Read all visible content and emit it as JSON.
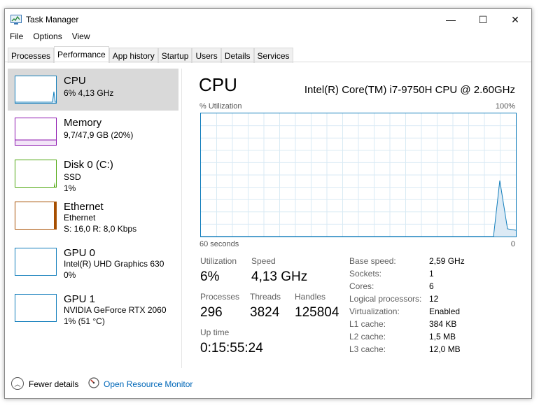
{
  "window": {
    "title": "Task Manager",
    "controls": {
      "minimize": "—",
      "maximize": "☐",
      "close": "✕"
    }
  },
  "menu": [
    "File",
    "Options",
    "View"
  ],
  "tabs": [
    {
      "label": "Processes",
      "active": false
    },
    {
      "label": "Performance",
      "active": true
    },
    {
      "label": "App history",
      "active": false
    },
    {
      "label": "Startup",
      "active": false
    },
    {
      "label": "Users",
      "active": false
    },
    {
      "label": "Details",
      "active": false
    },
    {
      "label": "Services",
      "active": false
    }
  ],
  "resources": [
    {
      "name": "CPU",
      "sub1": "6% 4,13 GHz",
      "sub2": "",
      "color": "#117dbb",
      "selected": true
    },
    {
      "name": "Memory",
      "sub1": "9,7/47,9 GB (20%)",
      "sub2": "",
      "color": "#8b12ae",
      "selected": false
    },
    {
      "name": "Disk 0 (C:)",
      "sub1": "SSD",
      "sub2": "1%",
      "color": "#4da60c",
      "selected": false
    },
    {
      "name": "Ethernet",
      "sub1": "Ethernet",
      "sub2": "S: 16,0 R: 8,0 Kbps",
      "color": "#a74f01",
      "selected": false
    },
    {
      "name": "GPU 0",
      "sub1": "Intel(R) UHD Graphics 630",
      "sub2": "0%",
      "color": "#117dbb",
      "selected": false
    },
    {
      "name": "GPU 1",
      "sub1": "NVIDIA GeForce RTX 2060",
      "sub2": "1% (51 °C)",
      "color": "#117dbb",
      "selected": false
    }
  ],
  "detail": {
    "title": "CPU",
    "model": "Intel(R) Core(TM) i7-9750H CPU @ 2.60GHz",
    "graph_label": "% Utilization",
    "graph_max": "100%",
    "graph_time": "60 seconds",
    "graph_min": "0",
    "utilization_label": "Utilization",
    "utilization": "6%",
    "speed_label": "Speed",
    "speed": "4,13 GHz",
    "processes_label": "Processes",
    "processes": "296",
    "threads_label": "Threads",
    "threads": "3824",
    "handles_label": "Handles",
    "handles": "125804",
    "uptime_label": "Up time",
    "uptime": "0:15:55:24",
    "specs": [
      {
        "key": "Base speed:",
        "value": "2,59 GHz"
      },
      {
        "key": "Sockets:",
        "value": "1"
      },
      {
        "key": "Cores:",
        "value": "6"
      },
      {
        "key": "Logical processors:",
        "value": "12"
      },
      {
        "key": "Virtualization:",
        "value": "Enabled"
      },
      {
        "key": "L1 cache:",
        "value": "384 KB"
      },
      {
        "key": "L2 cache:",
        "value": "1,5 MB"
      },
      {
        "key": "L3 cache:",
        "value": "12,0 MB"
      }
    ]
  },
  "footer": {
    "fewer_details": "Fewer details",
    "open_monitor": "Open Resource Monitor"
  },
  "colors": {
    "cpu_line": "#117dbb",
    "cpu_fill": "#f1f6fa",
    "grid": "#d9eaf4",
    "link": "#0067b8"
  }
}
